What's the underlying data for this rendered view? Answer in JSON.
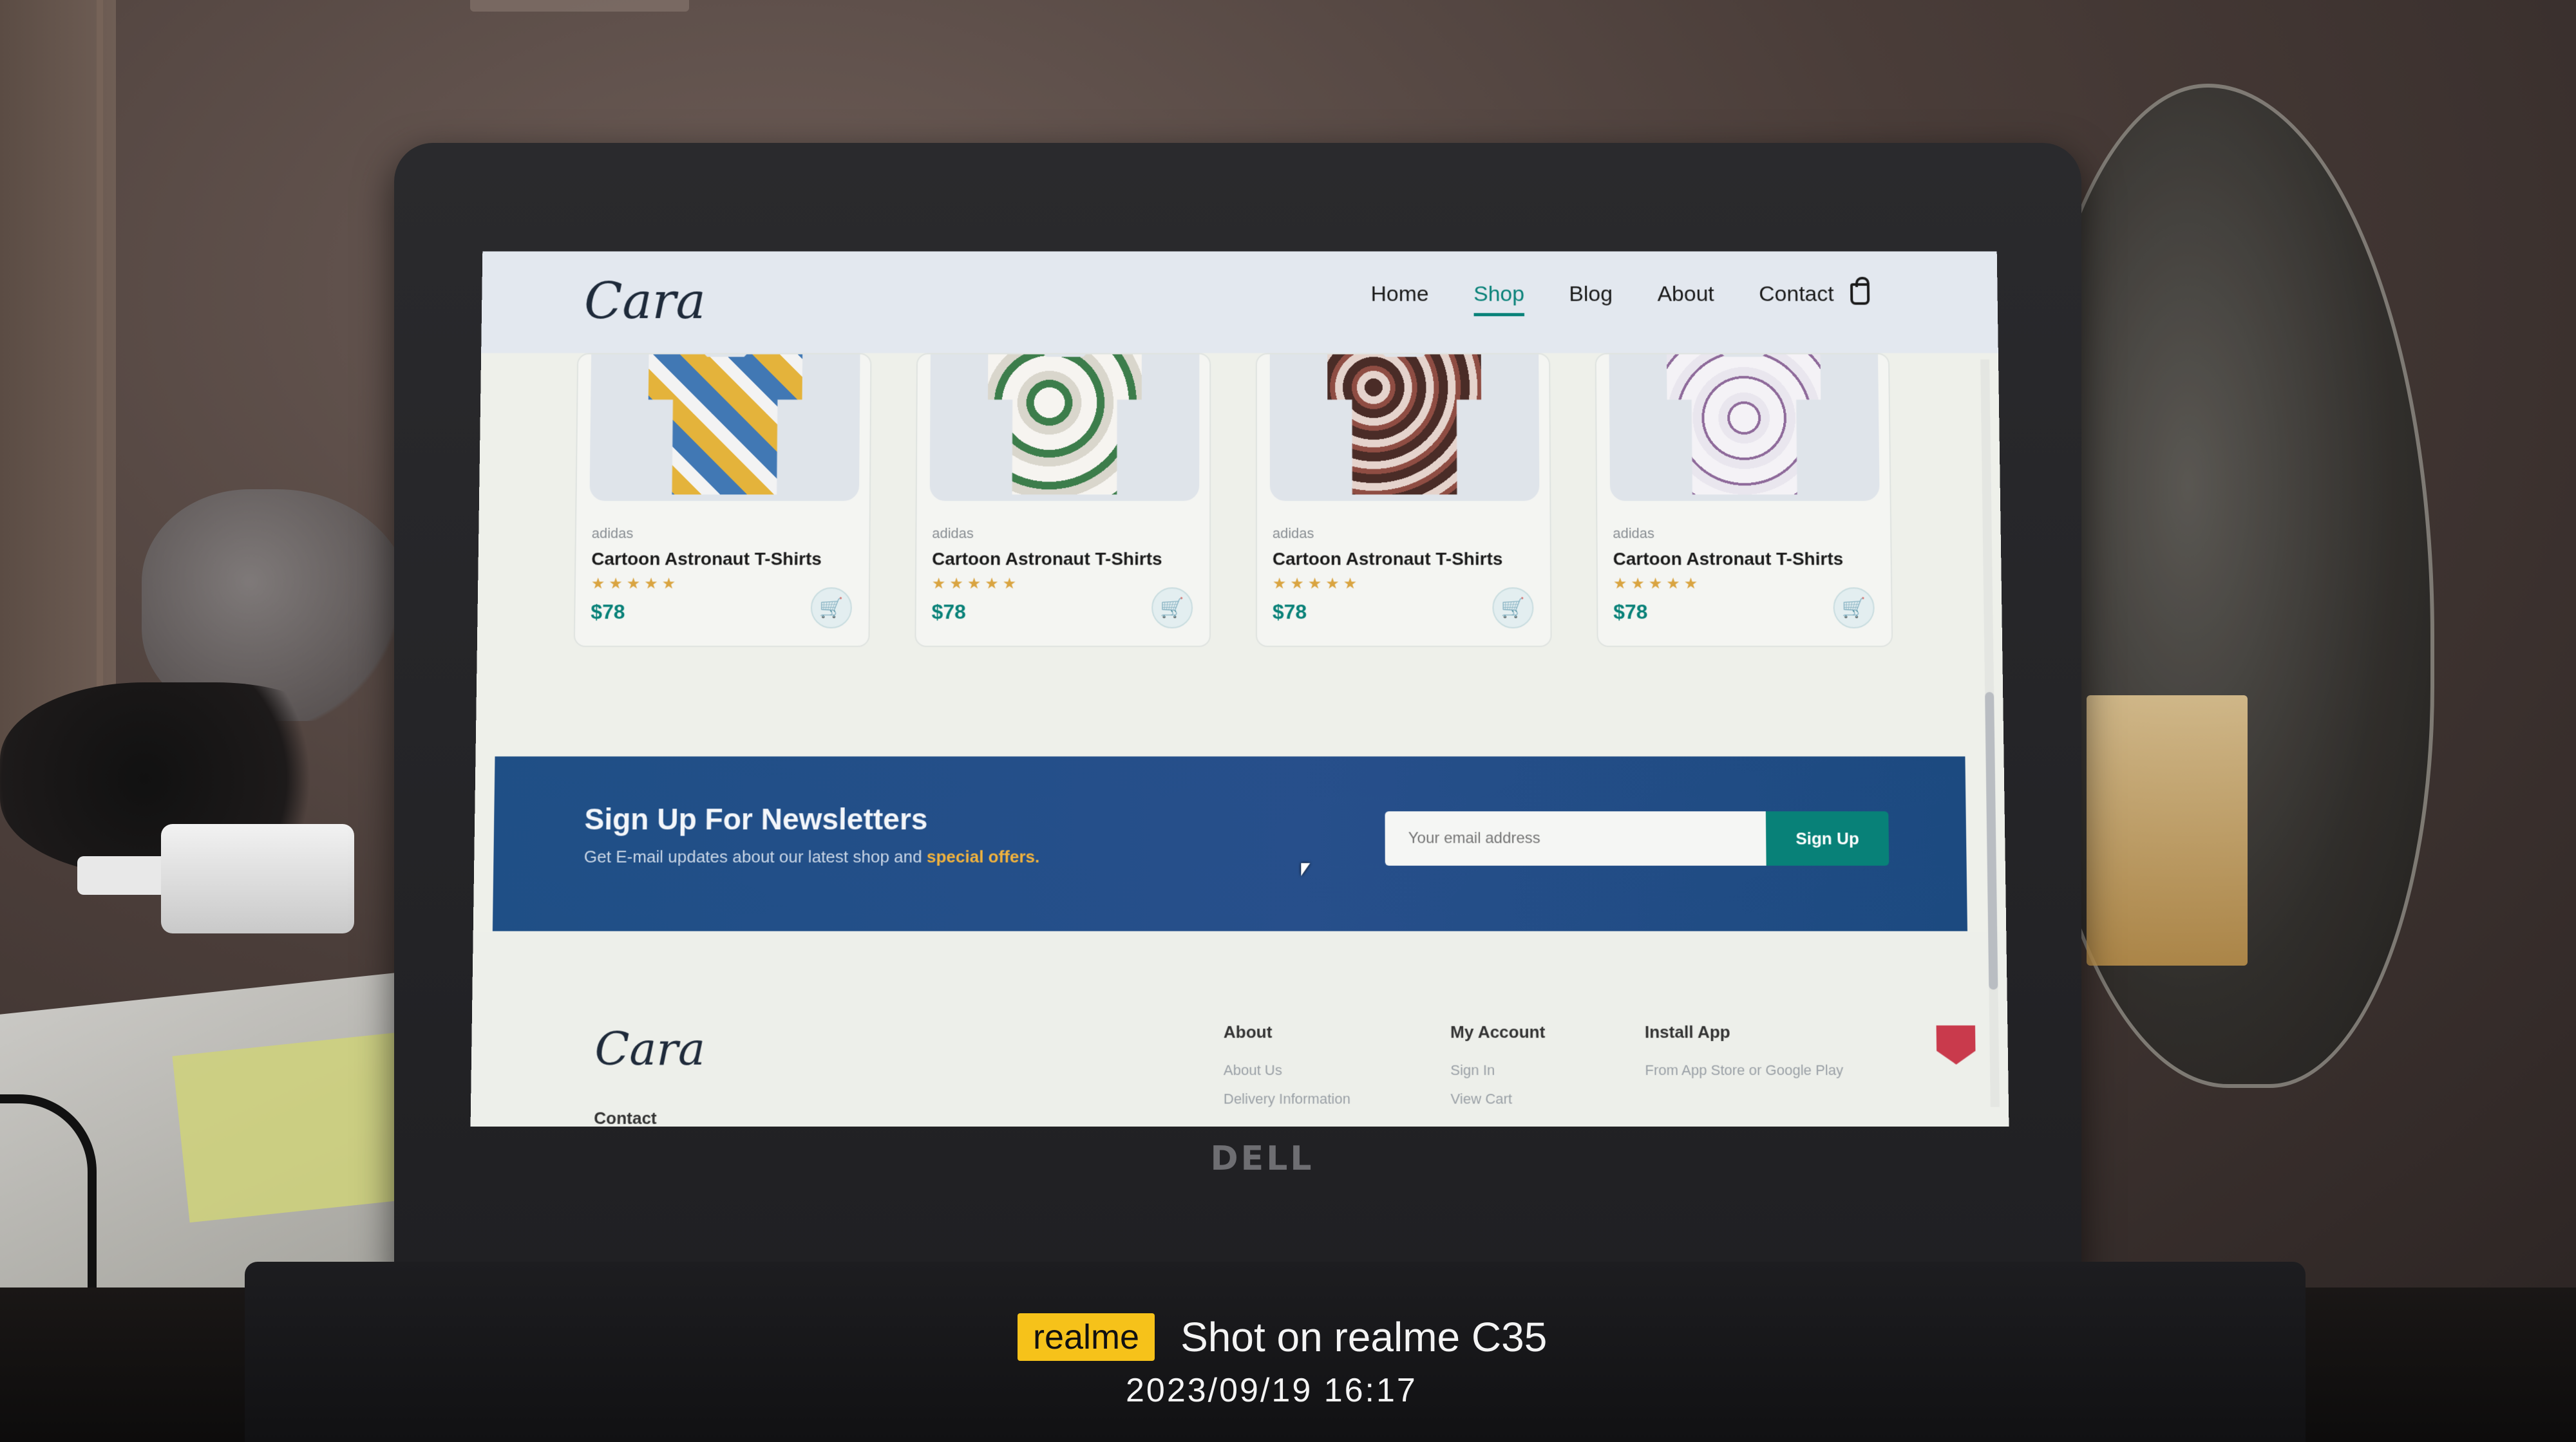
{
  "site": {
    "logo": "Cara",
    "nav": [
      "Home",
      "Shop",
      "Blog",
      "About",
      "Contact"
    ],
    "active_nav": "Shop"
  },
  "products": [
    {
      "brand": "adidas",
      "title": "Cartoon Astronaut T-Shirts",
      "rating": 5,
      "stars": "★★★★★",
      "price": "$78"
    },
    {
      "brand": "adidas",
      "title": "Cartoon Astronaut T-Shirts",
      "rating": 5,
      "stars": "★★★★★",
      "price": "$78"
    },
    {
      "brand": "adidas",
      "title": "Cartoon Astronaut T-Shirts",
      "rating": 5,
      "stars": "★★★★★",
      "price": "$78"
    },
    {
      "brand": "adidas",
      "title": "Cartoon Astronaut T-Shirts",
      "rating": 5,
      "stars": "★★★★★",
      "price": "$78"
    }
  ],
  "newsletter": {
    "title": "Sign Up For Newsletters",
    "subtitle_prefix": "Get E-mail updates about our latest shop and ",
    "subtitle_highlight": "special offers.",
    "email_placeholder": "Your email address",
    "button_label": "Sign Up"
  },
  "footer": {
    "logo": "Cara",
    "contact_heading": "Contact",
    "about": {
      "heading": "About",
      "links": [
        "About Us",
        "Delivery Information"
      ]
    },
    "account": {
      "heading": "My Account",
      "links": [
        "Sign In",
        "View Cart"
      ]
    },
    "install": {
      "heading": "Install App",
      "text": "From App Store or Google Play"
    }
  },
  "laptop_brand": "DELL",
  "watermark": {
    "brand": "realme",
    "text": "Shot on realme C35",
    "datetime": "2023/09/19  16:17"
  },
  "colors": {
    "accent": "#088178",
    "newsletter_bg": "#274f8b",
    "highlight": "#f2b33d"
  }
}
